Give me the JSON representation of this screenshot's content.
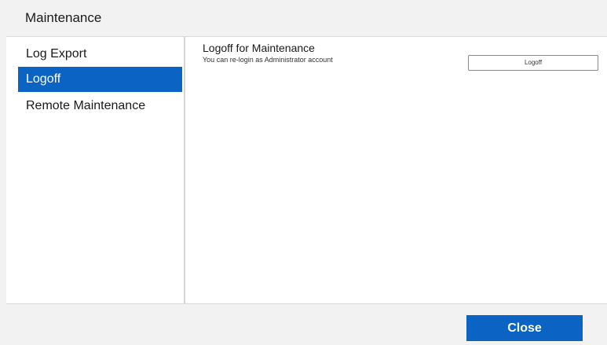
{
  "dialog": {
    "title": "Maintenance"
  },
  "sidebar": {
    "items": [
      {
        "label": "Log Export",
        "active": false
      },
      {
        "label": "Logoff",
        "active": true
      },
      {
        "label": "Remote Maintenance",
        "active": false
      }
    ]
  },
  "main": {
    "section_title": "Logoff for Maintenance",
    "section_description": "You can re-login as Administrator account",
    "logoff_button_label": "Logoff"
  },
  "footer": {
    "close_label": "Close"
  },
  "colors": {
    "accent": "#0b63c3",
    "background": "#f2f2f2",
    "panel": "#ffffff"
  }
}
